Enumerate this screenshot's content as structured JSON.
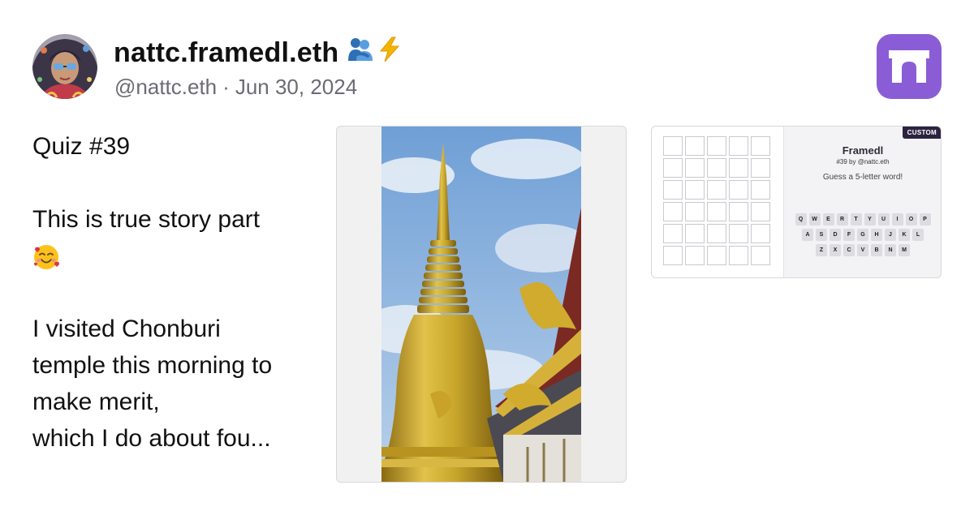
{
  "author": {
    "display_name": "nattc.framedl.eth",
    "name_emoji_icons": [
      "people-hugging-icon",
      "lightning-icon"
    ],
    "handle": "@nattc.eth",
    "separator": "·",
    "date": "Jun 30, 2024"
  },
  "app_logo_icon": "arch-gate-icon",
  "post": {
    "lines": [
      "Quiz #39",
      "",
      "This is true story part",
      "🥰",
      "",
      "I visited Chonburi",
      "temple this morning to",
      "make merit,",
      "which I do about fou..."
    ]
  },
  "embeds": {
    "photo_icon": "golden-stupa-photo",
    "frame": {
      "badge": "CUSTOM",
      "title": "Framedl",
      "subtitle": "#39 by @nattc.eth",
      "prompt": "Guess a 5-letter word!",
      "keyboard_rows": [
        [
          "Q",
          "W",
          "E",
          "R",
          "T",
          "Y",
          "U",
          "I",
          "O",
          "P"
        ],
        [
          "A",
          "S",
          "D",
          "F",
          "G",
          "H",
          "J",
          "K",
          "L"
        ],
        [
          "Z",
          "X",
          "C",
          "V",
          "B",
          "N",
          "M"
        ]
      ]
    }
  },
  "colors": {
    "app_logo_bg": "#8a5dd6",
    "badge_bg": "#2d2340",
    "handle_text": "#6b6b74"
  }
}
